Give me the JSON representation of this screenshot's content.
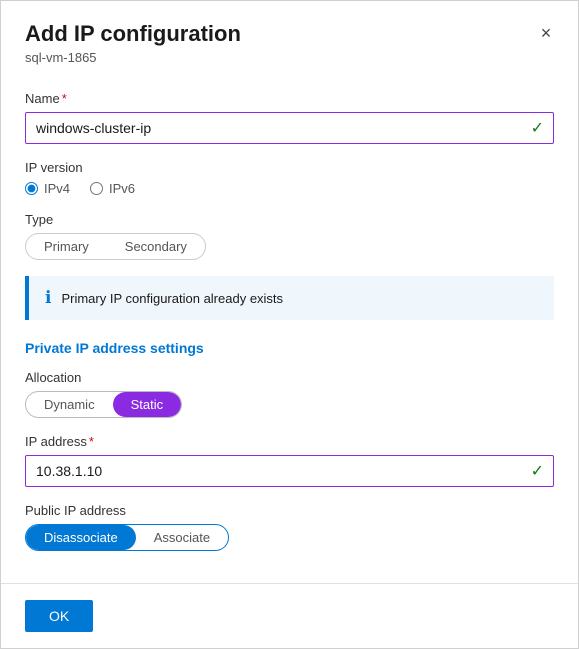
{
  "dialog": {
    "title": "Add IP configuration",
    "subtitle": "sql-vm-1865",
    "close_label": "×"
  },
  "name_field": {
    "label": "Name",
    "required": true,
    "value": "windows-cluster-ip",
    "placeholder": ""
  },
  "ip_version": {
    "label": "IP version",
    "options": [
      "IPv4",
      "IPv6"
    ],
    "selected": "IPv4"
  },
  "type": {
    "label": "Type",
    "options": [
      "Primary",
      "Secondary"
    ],
    "selected": "Primary"
  },
  "info_banner": {
    "message": "Primary IP configuration already exists"
  },
  "private_ip_section": {
    "title": "Private IP address settings"
  },
  "allocation": {
    "label": "Allocation",
    "options": [
      "Dynamic",
      "Static"
    ],
    "selected": "Static"
  },
  "ip_address": {
    "label": "IP address",
    "required": true,
    "value": "10.38.1.10"
  },
  "public_ip": {
    "label": "Public IP address",
    "options": [
      "Disassociate",
      "Associate"
    ],
    "selected": "Disassociate"
  },
  "footer": {
    "ok_label": "OK"
  }
}
